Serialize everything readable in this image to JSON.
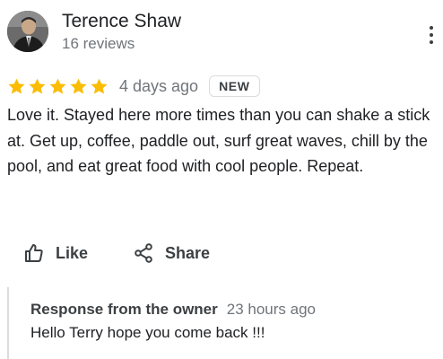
{
  "review": {
    "author": {
      "name": "Terence Shaw",
      "review_count": "16 reviews"
    },
    "menu_icon": "more-vertical-icon",
    "rating": {
      "stars": 5,
      "max_stars": 5,
      "star_color": "#fbbc04"
    },
    "date": "4 days ago",
    "badge": "NEW",
    "text": "Love it. Stayed here more times than you can shake a stick at. Get up, coffee, paddle out, surf great waves, chill by the pool, and eat great food with cool people. Repeat.",
    "actions": {
      "like": {
        "label": "Like",
        "icon": "thumbs-up-icon"
      },
      "share": {
        "label": "Share",
        "icon": "share-icon"
      }
    },
    "owner_response": {
      "title": "Response from the owner",
      "time": "23 hours ago",
      "text": "Hello Terry hope you come back !!!"
    }
  },
  "colors": {
    "text_primary": "#202124",
    "text_secondary": "#70757a",
    "border": "#dadce0"
  }
}
